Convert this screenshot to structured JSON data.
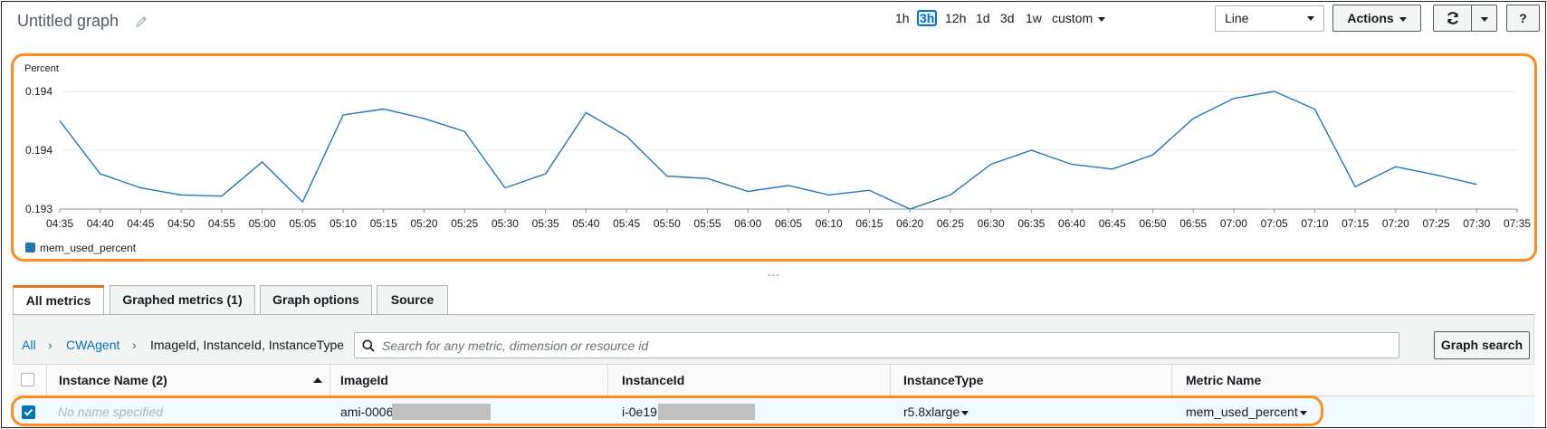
{
  "header": {
    "title": "Untitled graph",
    "time_ranges": [
      "1h",
      "3h",
      "12h",
      "1d",
      "3d",
      "1w"
    ],
    "selected_time_range": "3h",
    "custom_label": "custom",
    "chart_type_value": "Line",
    "actions_label": "Actions",
    "refresh_icon": "refresh-icon",
    "help_label": "?"
  },
  "chart_data": {
    "type": "line",
    "ylabel": "Percent",
    "y_tick_labels": [
      "0.194",
      "0.194",
      "0.193"
    ],
    "ylim": [
      0.193,
      0.194
    ],
    "x_tick_labels": [
      "04:35",
      "04:40",
      "04:45",
      "04:50",
      "04:55",
      "05:00",
      "05:05",
      "05:10",
      "05:15",
      "05:20",
      "05:25",
      "05:30",
      "05:35",
      "05:40",
      "05:45",
      "05:50",
      "05:55",
      "06:00",
      "06:05",
      "06:10",
      "06:15",
      "06:20",
      "06:25",
      "06:30",
      "06:35",
      "06:40",
      "06:45",
      "06:50",
      "06:55",
      "07:00",
      "07:05",
      "07:10",
      "07:15",
      "07:20",
      "07:25",
      "07:30",
      "07:35"
    ],
    "series": [
      {
        "name": "mem_used_percent",
        "color": "#1f77b4",
        "x": [
          "04:35",
          "04:40",
          "04:45",
          "04:50",
          "04:55",
          "05:00",
          "05:05",
          "05:10",
          "05:15",
          "05:20",
          "05:25",
          "05:30",
          "05:35",
          "05:40",
          "05:45",
          "05:50",
          "05:55",
          "06:00",
          "06:05",
          "06:10",
          "06:15",
          "06:20",
          "06:25",
          "06:30",
          "06:35",
          "06:40",
          "06:45",
          "06:50",
          "06:55",
          "07:00",
          "07:05",
          "07:10",
          "07:15",
          "07:20",
          "07:25",
          "07:30"
        ],
        "values": [
          0.19375,
          0.1933,
          0.19318,
          0.19312,
          0.19311,
          0.1934,
          0.19306,
          0.1938,
          0.19385,
          0.19377,
          0.19366,
          0.19318,
          0.1933,
          0.19382,
          0.19362,
          0.19328,
          0.19326,
          0.19315,
          0.1932,
          0.19312,
          0.19316,
          0.193,
          0.19312,
          0.19338,
          0.1935,
          0.19338,
          0.19334,
          0.19346,
          0.19377,
          0.19394,
          0.194,
          0.19385,
          0.19319,
          0.19336,
          0.19329,
          0.19321
        ]
      }
    ],
    "legend": [
      "mem_used_percent"
    ],
    "grid": true
  },
  "tabs": [
    {
      "label": "All metrics"
    },
    {
      "label": "Graphed metrics (1)"
    },
    {
      "label": "Graph options"
    },
    {
      "label": "Source"
    }
  ],
  "breadcrumb": {
    "all": "All",
    "namespace": "CWAgent",
    "dimensions": "ImageId, InstanceId, InstanceType"
  },
  "search": {
    "placeholder": "Search for any metric, dimension or resource id",
    "button_label": "Graph search"
  },
  "table": {
    "columns": [
      "Instance Name (2)",
      "ImageId",
      "InstanceId",
      "InstanceType",
      "Metric Name"
    ],
    "rows": [
      {
        "checked": true,
        "instance_name": "No name specified",
        "image_id": "ami-0006",
        "instance_id": "i-0e19",
        "instance_type": "r5.8xlarge",
        "metric_name": "mem_used_percent"
      }
    ]
  },
  "colors": {
    "accent": "#0073bb",
    "highlight": "#ff8c1a",
    "series": "#1f77b4"
  }
}
